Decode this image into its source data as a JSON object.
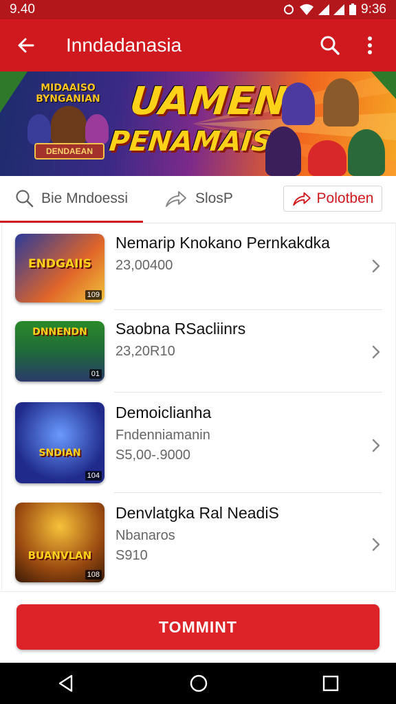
{
  "status": {
    "time": "9.40",
    "right_text": "9:36"
  },
  "appbar": {
    "title": "Inndadanasia",
    "back_icon": "arrow-left-icon",
    "search_icon": "search-icon",
    "more_icon": "more-vert-icon"
  },
  "banner": {
    "headline_line1": "UAMEN",
    "headline_line2": "PENAMAIS!",
    "logo_top": "MIDAAISO BYNGANIAN",
    "logo_bottom": "DENDAEAN"
  },
  "tabs": {
    "tab1": "Bie Mndoessi",
    "tab2": "SlosP",
    "action_button": "Polotben"
  },
  "items": [
    {
      "name": "Nemarip Knokano Pernkakdka",
      "sub": "",
      "price": "23,00400",
      "thumb_label": "ENDGAIIS",
      "badge": "109"
    },
    {
      "name": "Saobna RSacliinrs",
      "sub": "",
      "price": "23,20R10",
      "thumb_label": "DNNENDN",
      "badge": "01"
    },
    {
      "name": "Demoiclianha",
      "sub": "Fndenniamanin",
      "price": "S5,00-.9000",
      "thumb_label": "SNDIAN",
      "badge": "104"
    },
    {
      "name": "Denvlatgka Ral NeadiS",
      "sub": "Nbanaros",
      "price": "S910",
      "thumb_label": "BUANVLAN",
      "badge": "108"
    }
  ],
  "submit_label": "TOMMINT",
  "colors": {
    "primary": "#d0191f",
    "status": "#b3161b",
    "submit": "#dd2328"
  }
}
